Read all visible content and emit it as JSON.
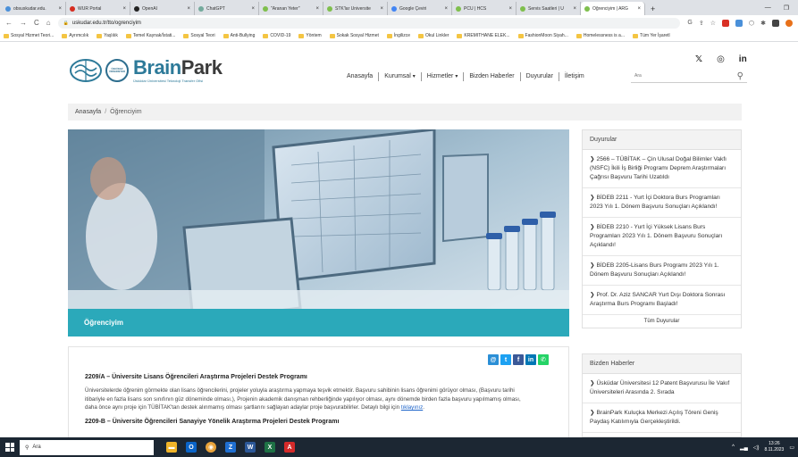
{
  "browser": {
    "tabs": [
      {
        "title": "obsuskudar.edu.",
        "color": "#4a90d9",
        "active": false
      },
      {
        "title": "WUR Portal",
        "color": "#d62d20",
        "active": false
      },
      {
        "title": "OpenAI",
        "color": "#222222",
        "active": false
      },
      {
        "title": "ChatGPT",
        "color": "#74aa9c",
        "active": false
      },
      {
        "title": "\"Aranan Yeter\"",
        "color": "#7fbf4d",
        "active": false
      },
      {
        "title": "STK'lar Üniversite",
        "color": "#7fbf4d",
        "active": false
      },
      {
        "title": "Google Çeviri",
        "color": "#4285f4",
        "active": false
      },
      {
        "title": "PCU | HCS",
        "color": "#7fbf4d",
        "active": false
      },
      {
        "title": "Servis Saatleri | Ü",
        "color": "#7fbf4d",
        "active": false
      },
      {
        "title": "Öğrenciyim | ARG",
        "color": "#7fbf4d",
        "active": true
      }
    ],
    "new_tab": "+",
    "url": "uskudar.edu.tr/tto/ogrenciyim",
    "bookmarks": [
      "Sosyal Hizmet Teori...",
      "Ayrımcılık",
      "Yaşlılık",
      "Temel Kaynak/İstati...",
      "Sosyal Teori",
      "Anti-Bullying",
      "COVID-19",
      "Yöntem",
      "Sokak Sosyal Hizmet",
      "İngilizce",
      "Okul Linkler",
      "KREMITHANE ELEK...",
      "FashionMoon Siyah...",
      "Homelessness is a...",
      "Tüm Yer İşaretl"
    ]
  },
  "site": {
    "brand_part1": "Brain",
    "brand_part2": "Park",
    "seal_text": "ÜSKÜDAR ÜNİVERSİTESİ",
    "brand_sub": "Üsküdar Üniversitesi Teknoloji Transfer Ofisi",
    "social": [
      "𝕏",
      "◎",
      "in"
    ],
    "nav": [
      {
        "label": "Anasayfa",
        "dropdown": false
      },
      {
        "label": "Kurumsal",
        "dropdown": true
      },
      {
        "label": "Hizmetler",
        "dropdown": true
      },
      {
        "label": "Bizden Haberler",
        "dropdown": false
      },
      {
        "label": "Duyurular",
        "dropdown": false
      },
      {
        "label": "İletişim",
        "dropdown": false
      }
    ],
    "search_placeholder": "Ara"
  },
  "breadcrumb": {
    "home": "Anasayfa",
    "separator": "/",
    "current": "Öğrenciyim"
  },
  "hero": {
    "caption": "Öğrenciyim"
  },
  "article": {
    "share": [
      {
        "label": "@",
        "color": "#2b8fd6"
      },
      {
        "label": "t",
        "color": "#1da1f2"
      },
      {
        "label": "f",
        "color": "#3b5998"
      },
      {
        "label": "in",
        "color": "#0077b5"
      },
      {
        "label": "✆",
        "color": "#25d366"
      }
    ],
    "title": "2209/A – Üniversite Lisans Öğrencileri Araştırma Projeleri Destek Programı",
    "body": "Üniversitelerde öğrenim görmekte olan lisans öğrencilerini, projeler yoluyla araştırma yapmaya teşvik etmektir. Başvuru sahibinin lisans öğrenimi görüyor olması, (Başvuru tarihi itibariyle en fazla lisans son sınıfının güz döneminde olması.), Projenin akademik danışman rehberliğinde yapılıyor olması, aynı dönemde birden fazla başvuru yapılmamış olması, daha önce aynı proje için TÜBİTAK'tan destek alınmamış olması şartlarını sağlayan adaylar proje başvurabilirler. Detaylı bilgi için ",
    "link": "tıklayınız",
    "body_end": ".",
    "next_title": "2209-B – Üniversite Öğrencileri Sanayiye Yönelik Araştırma Projeleri Destek Programı"
  },
  "sidebar": {
    "announcements": {
      "title": "Duyurular",
      "items": [
        "2566 – TÜBİTAK – Çin Ulusal Doğal Bilimler Vakfı (NSFC) İkili İş Birliği Programı Deprem Araştırmaları Çağrısı Başvuru Tarihi Uzatıldı",
        "BİDEB 2211 - Yurt İçi Doktora Burs Programları 2023 Yılı 1. Dönem Başvuru Sonuçları Açıklandı!",
        "BİDEB 2210 - Yurt İçi Yüksek Lisans Burs Programları 2023 Yılı 1. Dönem Başvuru Sonuçları Açıklandı!",
        "BİDEB 2205-Lisans Burs Programı 2023 Yılı 1. Dönem Başvuru Sonuçları Açıklandı!",
        "Prof. Dr. Aziz SANCAR Yurt Dışı Doktora Sonrası Araştırma Burs Programı Başladı!"
      ],
      "more": "Tüm Duyurular"
    },
    "news": {
      "title": "Bizden Haberler",
      "items": [
        "Üsküdar Üniversitesi 12 Patent Başvurusu İle Vakıf Üniversiteleri Arasında 2. Sırada",
        "BrainPark Kuluçka Merkezi Açılış Töreni Geniş Paydaş Katılımıyla Gerçekleştirildi."
      ]
    }
  },
  "taskbar": {
    "search": "Ara",
    "time": "13:26",
    "date": "8.11.2023"
  }
}
